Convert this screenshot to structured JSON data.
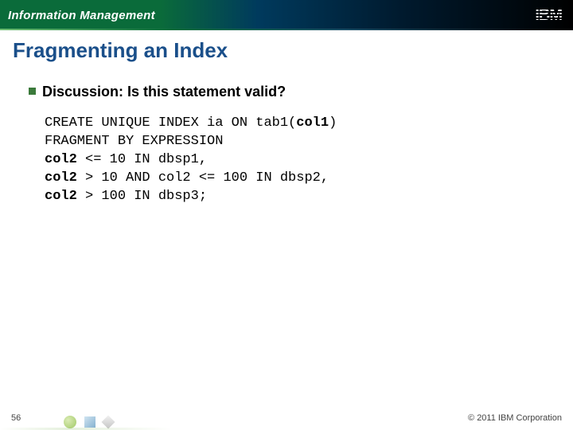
{
  "header": {
    "product_line": "Information Management",
    "logo_text": "IBM"
  },
  "slide": {
    "title": "Fragmenting an Index",
    "bullet": "Discussion: Is this statement valid?",
    "code": {
      "l1a": "CREATE UNIQUE INDEX ia ON tab1(",
      "l1b": "col1",
      "l1c": ")",
      "l2": "FRAGMENT BY EXPRESSION",
      "l3a": "col2",
      "l3b": " <= 10 IN dbsp1,",
      "l4a": "col2",
      "l4b": " > 10 AND col2 <= 100 IN dbsp2,",
      "l5a": "col2",
      "l5b": " > 100 IN dbsp3;"
    }
  },
  "footer": {
    "page": "56",
    "copyright": "© 2011 IBM Corporation"
  }
}
